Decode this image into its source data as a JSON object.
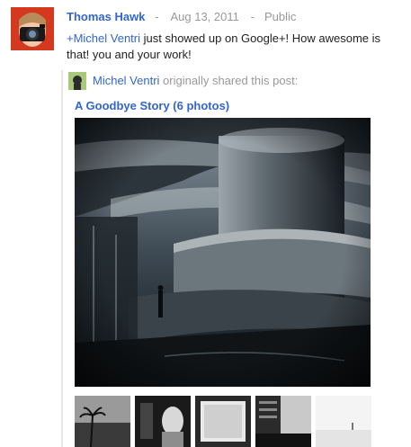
{
  "post": {
    "author": "Thomas Hawk",
    "separator": "-",
    "date": "Aug 13, 2011",
    "visibility": "Public",
    "mention": "+Michel Ventri",
    "text_rest": " just showed up on Google+! How awesome is that! you and your work!"
  },
  "reshare": {
    "sharer": "Michel Ventri",
    "shared_label": " originally shared this post:",
    "album_title": "A Goodbye Story (6 photos)"
  },
  "icons": {
    "avatar": "photographer-avatar",
    "sharer_avatar": "sharer-avatar"
  },
  "colors": {
    "link": "#3366cc",
    "meta": "#999999"
  },
  "photos": {
    "thumbnails": [
      "thumb-palm-beach",
      "thumb-portrait",
      "thumb-light-square",
      "thumb-building",
      "thumb-white-seascape"
    ]
  }
}
